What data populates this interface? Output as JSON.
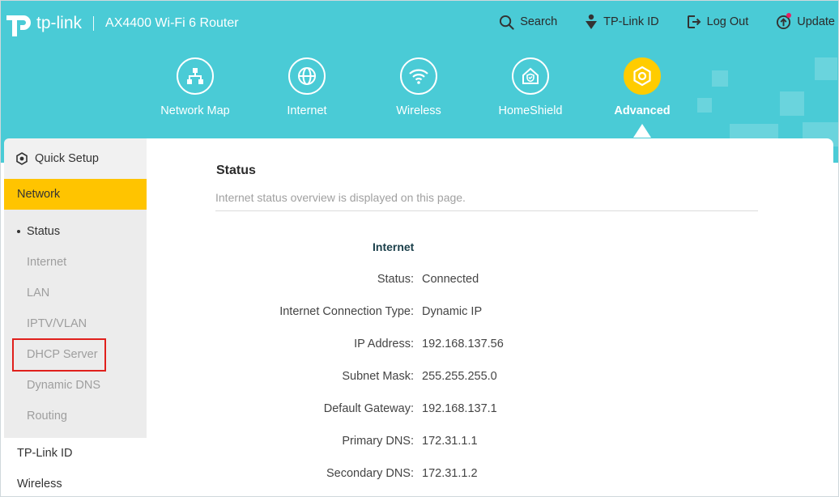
{
  "header": {
    "brand": "tp-link",
    "model": "AX4400 Wi-Fi 6 Router",
    "bg_color": "#4acbd6",
    "links": [
      {
        "label": "Search",
        "icon": "search-icon"
      },
      {
        "label": "TP-Link ID",
        "icon": "user-icon"
      },
      {
        "label": "Log Out",
        "icon": "logout-icon"
      },
      {
        "label": "Update",
        "icon": "update-icon"
      }
    ]
  },
  "nav": [
    {
      "label": "Network Map",
      "icon": "network-map-icon"
    },
    {
      "label": "Internet",
      "icon": "globe-icon"
    },
    {
      "label": "Wireless",
      "icon": "wifi-icon"
    },
    {
      "label": "HomeShield",
      "icon": "homeshield-icon"
    },
    {
      "label": "Advanced",
      "icon": "gear-icon",
      "active": true,
      "accent": "#ffcc00"
    }
  ],
  "sidebar": {
    "quick_setup": "Quick Setup",
    "network": "Network",
    "network_items": [
      "Status",
      "Internet",
      "LAN",
      "IPTV/VLAN",
      "DHCP Server",
      "Dynamic DNS",
      "Routing"
    ],
    "active_item": "Status",
    "bottom_items": [
      "TP-Link ID",
      "Wireless"
    ],
    "highlight_color": "#ffc400"
  },
  "main": {
    "title": "Status",
    "subtitle": "Internet status overview is displayed on this page.",
    "section": "Internet",
    "rows": [
      {
        "label": "Status:",
        "value": "Connected"
      },
      {
        "label": "Internet Connection Type:",
        "value": "Dynamic IP"
      },
      {
        "label": "IP Address:",
        "value": "192.168.137.56"
      },
      {
        "label": "Subnet Mask:",
        "value": "255.255.255.0"
      },
      {
        "label": "Default Gateway:",
        "value": "192.168.137.1"
      },
      {
        "label": "Primary DNS:",
        "value": "172.31.1.1"
      },
      {
        "label": "Secondary DNS:",
        "value": "172.31.1.2"
      }
    ]
  }
}
